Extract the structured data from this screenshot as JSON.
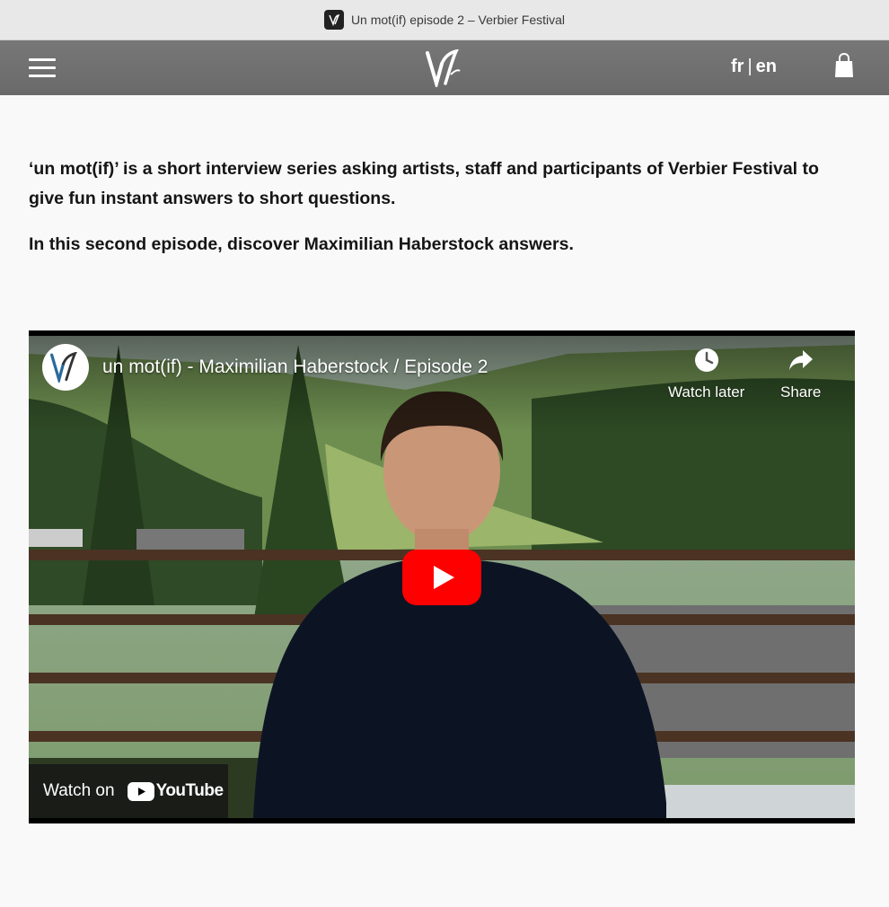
{
  "window": {
    "title": "Un mot(if) episode 2 – Verbier Festival"
  },
  "nav": {
    "lang_fr": "fr",
    "lang_sep": "|",
    "lang_en": "en"
  },
  "article": {
    "paragraph1": "‘un mot(if)’ is a short interview series asking artists, staff and participants of Verbier Festival to give fun instant answers to short questions.",
    "paragraph2": "In this second episode, discover Maximilian Haberstock answers."
  },
  "video": {
    "title": "un mot(if) - Maximilian Haberstock / Episode 2",
    "watch_later": "Watch later",
    "share": "Share",
    "watch_on": "Watch on",
    "youtube": "YouTube"
  },
  "colors": {
    "youtube_red": "#ff0000",
    "navbar": "#707070",
    "logo_blue": "#2a6a9a"
  },
  "icons": [
    "menu-icon",
    "verbier-logo",
    "shopping-bag-icon",
    "clock-icon",
    "share-arrow-icon",
    "play-icon"
  ]
}
